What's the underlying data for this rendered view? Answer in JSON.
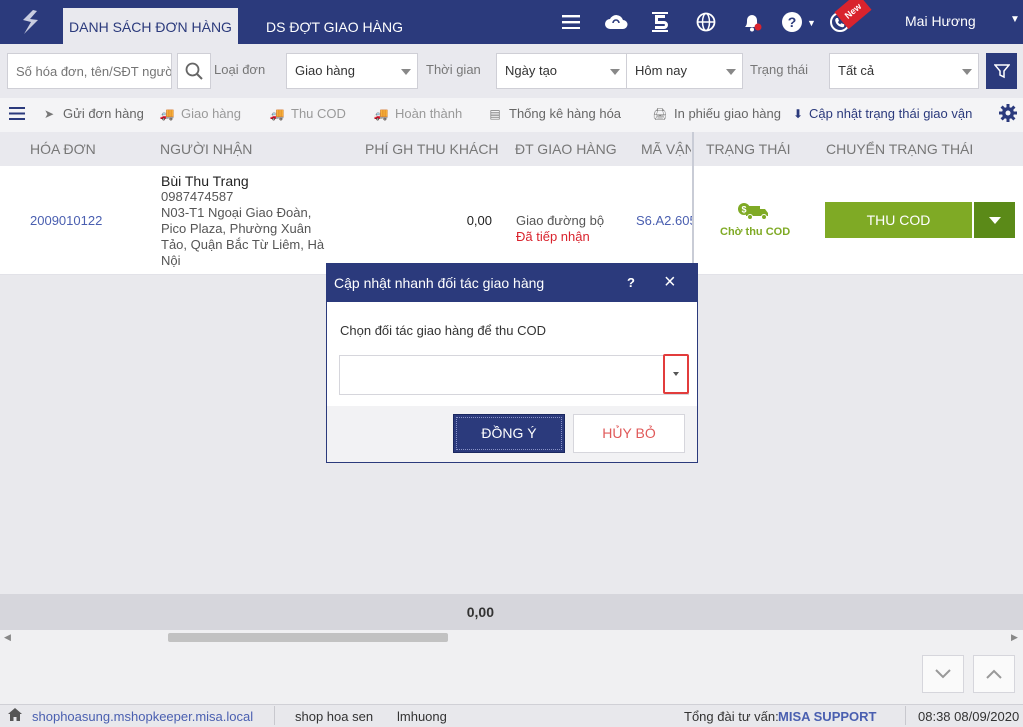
{
  "app": {
    "tabs": [
      {
        "label": "DANH SÁCH ĐƠN HÀNG",
        "active": true
      },
      {
        "label": "DS ĐỢT GIAO HÀNG",
        "active": false
      }
    ],
    "badge_new": "New",
    "user_name": "Mai Hương",
    "icons": [
      "menu-icon",
      "cloud-sync-icon",
      "five-icon",
      "globe-icon",
      "bell-icon",
      "help-icon",
      "support-phone-icon"
    ],
    "colors": {
      "primary": "#2b3a7c",
      "accent_green": "#7faa25",
      "link_blue": "#4a5fb0",
      "danger": "#d9232d"
    }
  },
  "filters": {
    "search_placeholder": "Số hóa đơn, tên/SĐT người",
    "type_label": "Loại đơn",
    "type_value": "Giao hàng",
    "time_label": "Thời gian",
    "time_field_value": "Ngày tạo",
    "time_range_value": "Hôm nay",
    "status_label": "Trạng thái",
    "status_value": "Tất cả"
  },
  "toolbar": {
    "send": "Gửi đơn hàng",
    "deliver": "Giao hàng",
    "cod": "Thu COD",
    "complete": "Hoàn thành",
    "stats": "Thống kê hàng hóa",
    "print": "In phiếu giao hàng",
    "update": "Cập nhật trạng thái giao vận"
  },
  "table": {
    "headers": [
      "HÓA ĐƠN",
      "NGƯỜI NHẬN",
      "PHÍ GH THU KHÁCH",
      "ĐT GIAO HÀNG",
      "MÃ VẬN",
      "TRẠNG THÁI",
      "CHUYỂN TRẠNG THÁI"
    ],
    "rows": [
      {
        "invoice": "2009010122",
        "receiver_name": "Bùi Thu Trang",
        "receiver_phone": "0987474587",
        "receiver_addr1": "N03-T1 Ngoại Giao Đoàn,",
        "receiver_addr2": "Pico Plaza, Phường Xuân",
        "receiver_addr3": "Tảo, Quận Bắc Từ Liêm, Hà",
        "receiver_addr4": "Nội",
        "fee": "0,00",
        "partner": "Giao đường bộ",
        "partner_status": "Đã tiếp nhận",
        "tracking": "S6.A2.605",
        "status": "Chờ thu COD",
        "action": "THU COD"
      }
    ],
    "total_fee": "0,00"
  },
  "statusbar": {
    "domain": "shophoasung.mshopkeeper.misa.local",
    "shop": "shop hoa sen",
    "user": "lmhuong",
    "hotline_label": "Tổng đài tư vấn:",
    "hotline_value": "MISA SUPPORT",
    "datetime": "08:38 08/09/2020"
  },
  "dialog": {
    "title": "Cập nhật nhanh đối tác giao hàng",
    "help": "?",
    "close": "×",
    "prompt": "Chọn đối tác giao hàng để thu COD",
    "select_value": "",
    "ok": "ĐỒNG Ý",
    "cancel": "HỦY BỎ"
  }
}
